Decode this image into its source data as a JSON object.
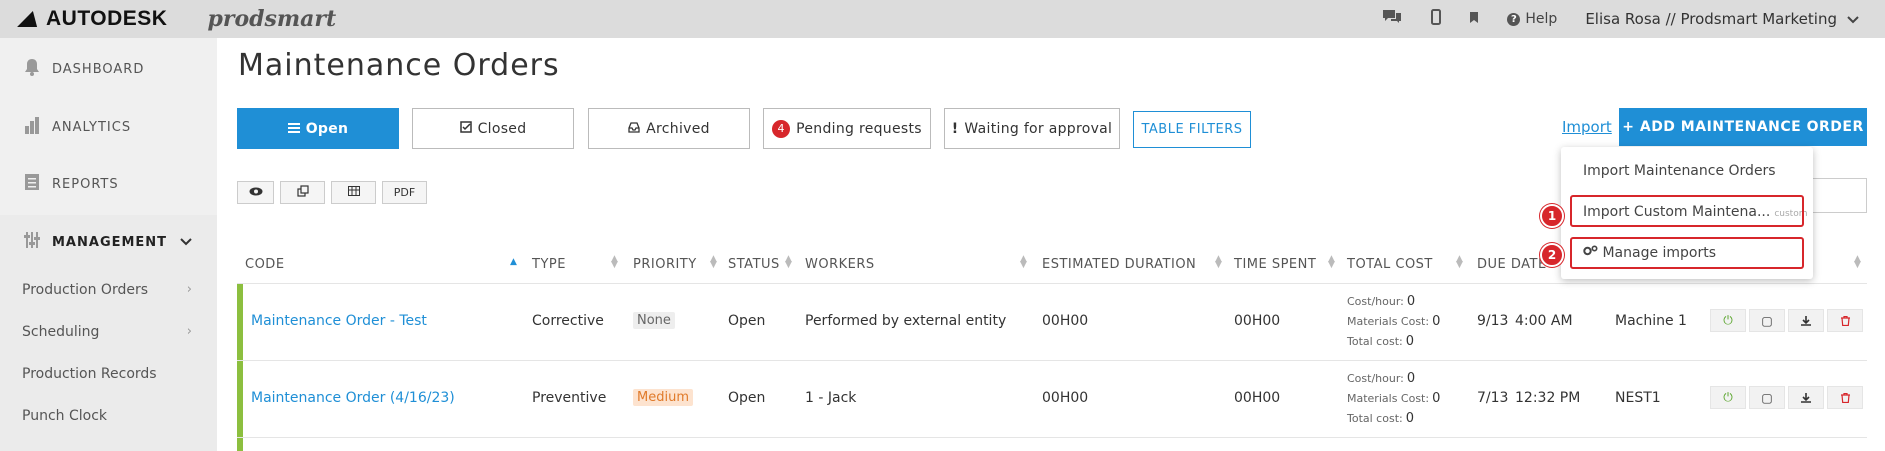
{
  "topbar": {
    "brand": "AUTODESK",
    "product": "prodsmart",
    "help_label": "Help",
    "user": "Elisa Rosa // Prodsmart Marketing"
  },
  "sidebar": {
    "items": [
      {
        "label": "DASHBOARD"
      },
      {
        "label": "ANALYTICS"
      },
      {
        "label": "REPORTS"
      },
      {
        "label": "MANAGEMENT"
      }
    ],
    "sub_items": [
      {
        "label": "Production Orders"
      },
      {
        "label": "Scheduling"
      },
      {
        "label": "Production Records"
      },
      {
        "label": "Punch Clock"
      }
    ]
  },
  "main": {
    "title": "Maintenance Orders",
    "tabs": {
      "open": "Open",
      "closed": "Closed",
      "archived": "Archived",
      "pending_count": "4",
      "pending": "Pending requests",
      "waiting": "Waiting for approval",
      "filters": "TABLE FILTERS"
    },
    "import_label": "Import",
    "add_label": "+ ADD MAINTENANCE ORDER",
    "tools": {
      "pdf": "PDF"
    }
  },
  "table": {
    "headers": {
      "code": "CODE",
      "type": "TYPE",
      "priority": "PRIORITY",
      "status": "STATUS",
      "workers": "WORKERS",
      "duration": "ESTIMATED DURATION",
      "time_spent": "TIME SPENT",
      "total_cost": "TOTAL COST",
      "due_date": "DUE DATE"
    },
    "cost_labels": {
      "hour": "Cost/hour:",
      "materials": "Materials Cost:",
      "total": "Total cost:"
    },
    "rows": [
      {
        "code": "Maintenance Order - Test",
        "type": "Corrective",
        "priority": "None",
        "status": "Open",
        "workers": "Performed by external entity",
        "duration": "00H00",
        "time_spent": "00H00",
        "cost_hour": "0",
        "cost_materials": "0",
        "cost_total": "0",
        "due_date": "9/13",
        "due_time": "4:00 AM",
        "machine": "Machine 1"
      },
      {
        "code": "Maintenance Order (4/16/23)",
        "type": "Preventive",
        "priority": "Medium",
        "status": "Open",
        "workers": "1 - Jack",
        "duration": "00H00",
        "time_spent": "00H00",
        "cost_hour": "0",
        "cost_materials": "0",
        "cost_total": "0",
        "due_date": "7/13",
        "due_time": "12:32 PM",
        "machine": "NEST1"
      }
    ]
  },
  "dropdown": {
    "item1": "Import Maintenance Orders",
    "item2": "Import Custom Maintena...",
    "item2_tag": "custom",
    "item3": "Manage imports",
    "step1": "1",
    "step2": "2"
  },
  "colors": {
    "accent": "#1f8fd6",
    "row_marker": "#8cbf3f",
    "highlight": "#d7262b"
  }
}
